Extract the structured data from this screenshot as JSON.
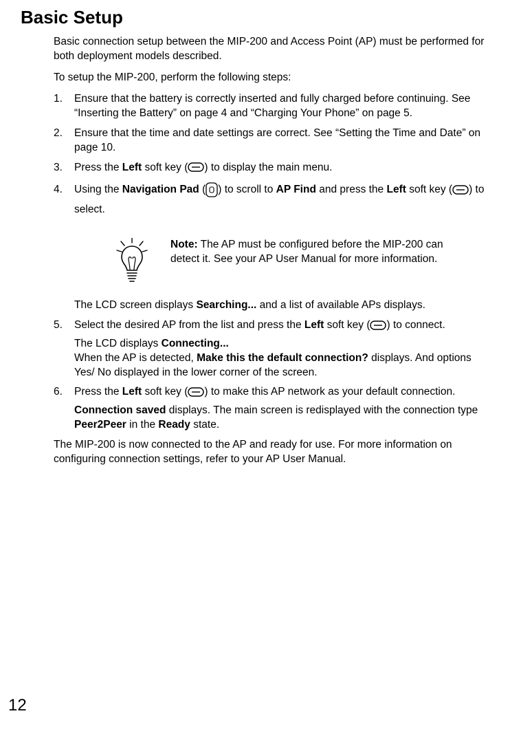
{
  "title": "Basic Setup",
  "intro1": "Basic connection setup between the MIP-200 and Access Point (AP) must be performed for both deployment models described.",
  "intro2": "To setup the MIP-200, perform the following steps:",
  "steps": {
    "s1": "Ensure that the battery is correctly inserted and fully charged before continuing. See “Inserting the Battery” on page 4 and “Charging Your Phone” on page 5.",
    "s2": "Ensure that the time and date settings are correct. See “Setting the Time and Date” on page 10.",
    "s3": {
      "a": "Press the ",
      "left": "Left",
      "b": " soft key (",
      "c": ") to display the main menu."
    },
    "s4": {
      "a": "Using the ",
      "navpad": "Navigation Pad",
      "b": " (",
      "c": ") to scroll to ",
      "apfind": "AP Find",
      "d": " and press the ",
      "left": "Left",
      "e": " soft key (",
      "f": ") to select."
    },
    "note": {
      "label": "Note:",
      "body": " The AP must be configured before the MIP-200 can detect it. See your AP User Manual for more infor­mation."
    },
    "searching": {
      "a": "The LCD screen displays ",
      "b": "Searching...",
      "c": " and a list of available APs displays."
    },
    "s5": {
      "a": "Select the desired AP from the list and press the ",
      "left": "Left",
      "b": " soft key (",
      "c": ") to connect.",
      "d": "The LCD displays ",
      "connecting": "Connecting...",
      "e": "When the AP is detected, ",
      "mdef": "Make this the default connection?",
      "f": " displays. And options Yes/ No displayed in the lower corner of the screen."
    },
    "s6": {
      "a": "Press the ",
      "left": "Left",
      "b": " soft key (",
      "c": ") to make this AP network as your default connection.",
      "saved": "Connection saved",
      "d": " displays. The main screen is redisplayed with the con­nection type ",
      "p2p": "Peer2Peer",
      "e": " in the ",
      "ready": "Ready",
      "f": " state."
    }
  },
  "closing": "The MIP-200 is now connected to the AP and ready for use. For more information on configuring connection settings, refer to your AP User Manual.",
  "page_number": "12"
}
